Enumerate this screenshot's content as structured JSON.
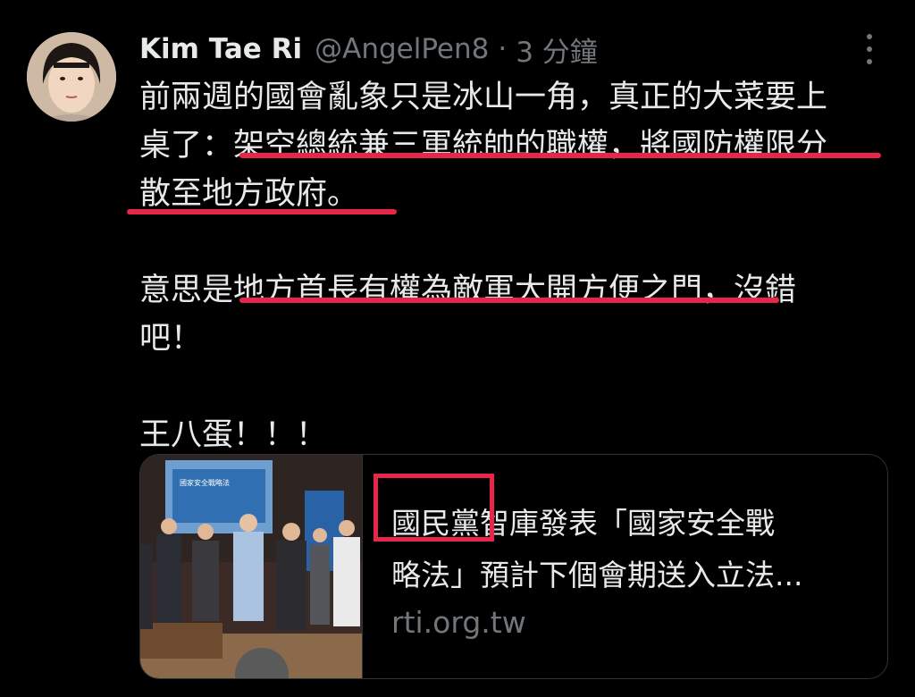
{
  "author": {
    "name": "Kim Tae Ri",
    "handle": "@AngelPen8",
    "separator": "·",
    "time": "3 分鐘"
  },
  "tweet": {
    "paragraphs": [
      {
        "lines": [
          "前兩週的國會亂象只是冰山一角，真正的大菜要上",
          "桌了：架空總統兼三軍統帥的職權，將國防權限分",
          "散至地方政府。"
        ]
      },
      {
        "lines": [
          "意思是地方首長有權為敵軍大開方便之門，沒錯",
          "吧！"
        ]
      },
      {
        "lines": [
          "王八蛋！！！"
        ]
      }
    ]
  },
  "link_card": {
    "title_lines": [
      "國民黨智庫發表「國家安全戰",
      "略法」預計下個會期送入立法..."
    ],
    "domain": "rti.org.tw",
    "thumbnail_screen_text": "國家安全戰略法"
  },
  "annotation_color": "#e8264a"
}
